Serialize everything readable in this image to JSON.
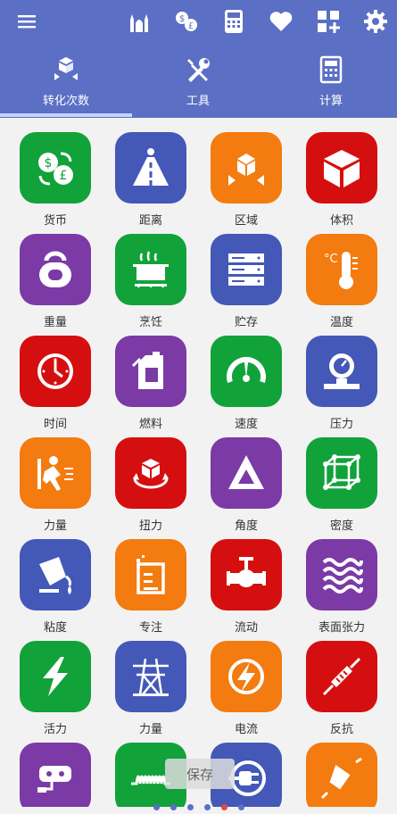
{
  "topbar": {
    "icons": [
      "menu-icon",
      "mosque-icon",
      "currency-exchange-icon",
      "calculator-device-icon",
      "heart-icon",
      "add-widget-icon",
      "gear-icon"
    ]
  },
  "tabs": [
    {
      "label": "转化次数",
      "icon": "convert-icon",
      "active": true
    },
    {
      "label": "工具",
      "icon": "tools-icon",
      "active": false
    },
    {
      "label": "计算",
      "icon": "calculator-icon",
      "active": false
    }
  ],
  "items": [
    {
      "label": "货币",
      "color": "#12a23a",
      "icon": "currency-icon"
    },
    {
      "label": "距离",
      "color": "#4458b8",
      "icon": "road-icon"
    },
    {
      "label": "区域",
      "color": "#f37b0f",
      "icon": "area-icon"
    },
    {
      "label": "体积",
      "color": "#d50f0f",
      "icon": "cube-icon"
    },
    {
      "label": "重量",
      "color": "#7b3aa5",
      "icon": "kettlebell-icon"
    },
    {
      "label": "烹饪",
      "color": "#12a23a",
      "icon": "cooking-pot-icon"
    },
    {
      "label": "贮存",
      "color": "#4458b8",
      "icon": "storage-icon"
    },
    {
      "label": "温度",
      "color": "#f37b0f",
      "icon": "thermometer-icon"
    },
    {
      "label": "时间",
      "color": "#d50f0f",
      "icon": "clock-icon"
    },
    {
      "label": "燃料",
      "color": "#7b3aa5",
      "icon": "fuel-can-icon"
    },
    {
      "label": "速度",
      "color": "#12a23a",
      "icon": "speedometer-icon"
    },
    {
      "label": "压力",
      "color": "#4458b8",
      "icon": "pressure-gauge-icon"
    },
    {
      "label": "力量",
      "color": "#f37b0f",
      "icon": "runner-icon"
    },
    {
      "label": "扭力",
      "color": "#d50f0f",
      "icon": "torque-icon"
    },
    {
      "label": "角度",
      "color": "#7b3aa5",
      "icon": "triangle-icon"
    },
    {
      "label": "密度",
      "color": "#12a23a",
      "icon": "lattice-cube-icon"
    },
    {
      "label": "粘度",
      "color": "#4458b8",
      "icon": "pour-bucket-icon"
    },
    {
      "label": "专注",
      "color": "#f37b0f",
      "icon": "beaker-icon"
    },
    {
      "label": "流动",
      "color": "#d50f0f",
      "icon": "valve-icon"
    },
    {
      "label": "表面张力",
      "color": "#7b3aa5",
      "icon": "waves-icon"
    },
    {
      "label": "活力",
      "color": "#12a23a",
      "icon": "lightning-icon"
    },
    {
      "label": "力量",
      "color": "#4458b8",
      "icon": "power-tower-icon"
    },
    {
      "label": "电流",
      "color": "#f37b0f",
      "icon": "electric-current-icon"
    },
    {
      "label": "反抗",
      "color": "#d50f0f",
      "icon": "resistor-icon"
    },
    {
      "label": "",
      "color": "#7b3aa5",
      "icon": "power-strip-icon"
    },
    {
      "label": "",
      "color": "#12a23a",
      "icon": "inductor-icon"
    },
    {
      "label": "",
      "color": "#4458b8",
      "icon": "plug-icon"
    },
    {
      "label": "",
      "color": "#f37b0f",
      "icon": "capacitor-icon"
    }
  ],
  "save_label": "保存",
  "pager": {
    "count": 6,
    "active": 4
  }
}
